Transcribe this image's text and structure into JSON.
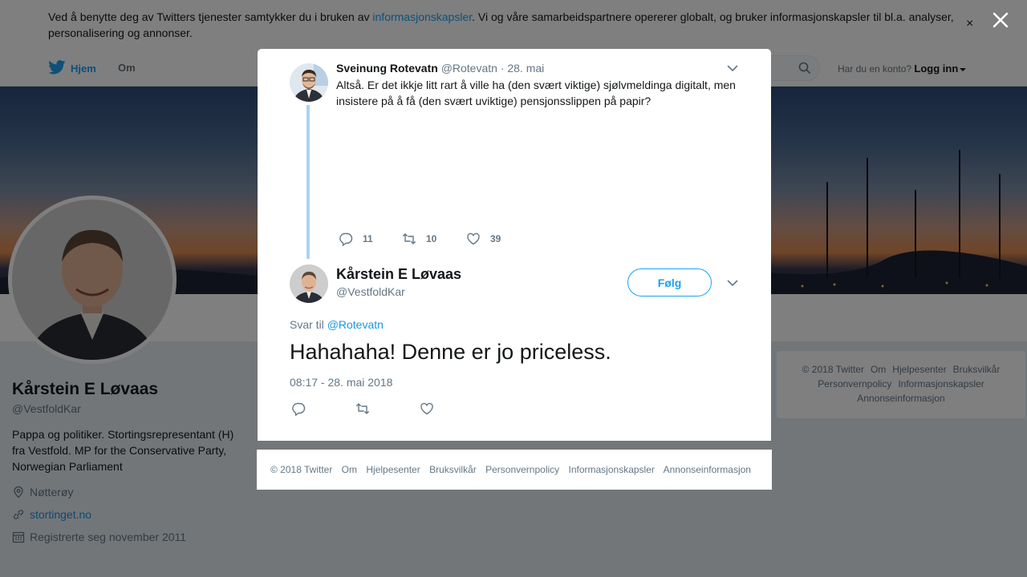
{
  "cookie_banner": {
    "text_before": "Ved å benytte deg av Twitters tjenester samtykker du i bruken av ",
    "link": "informasjonskapsler",
    "text_after": ". Vi og våre samarbeidspartnere opererer globalt, og bruker informasjonskapsler til bl.a. analyser, personalisering og annonser.",
    "close": "×"
  },
  "nav": {
    "home": "Hjem",
    "about": "Om",
    "login_prompt": "Har du en konto?",
    "login": "Logg inn"
  },
  "profile": {
    "name": "Kårstein E Løvaas",
    "handle": "@VestfoldKar",
    "bio": "Pappa og politiker. Stortingsrepresentant (H) fra Vestfold. MP for the Conservative Party, Norwegian Parliament",
    "location": "Nøtterøy",
    "website": "stortinget.no",
    "joined": "Registrerte seg november 2011"
  },
  "side_footer": {
    "items": [
      "© 2018 Twitter",
      "Om",
      "Hjelpesenter",
      "Bruksvilkår",
      "Personvernpolicy",
      "Informasjonskapsler",
      "Annonseinformasjon"
    ]
  },
  "parent_tweet": {
    "name": "Sveinung Rotevatn",
    "handle": "@Rotevatn",
    "date": "· 28. mai",
    "text": "Altså. Er det ikkje litt rart å ville ha (den svært viktige) sjølvmeldinga digitalt, men insistere på å få (den svært uviktige) pensjonsslippen på papir?",
    "replies": "11",
    "retweets": "10",
    "likes": "39"
  },
  "main_tweet": {
    "name": "Kårstein E Løvaas",
    "handle": "@VestfoldKar",
    "follow": "Følg",
    "reply_prefix": "Svar til",
    "reply_to": "@Rotevatn",
    "text": "Hahahaha! Denne er jo priceless.",
    "timestamp": "08:17 - 28. mai 2018"
  },
  "modal_footer": {
    "items": [
      "© 2018 Twitter",
      "Om",
      "Hjelpesenter",
      "Bruksvilkår",
      "Personvernpolicy",
      "Informasjonskapsler",
      "Annonseinformasjon"
    ]
  },
  "icons": {
    "bird": "twitter-bird-icon",
    "search": "search-icon",
    "close": "close-icon",
    "reply": "reply-icon",
    "retweet": "retweet-icon",
    "like": "heart-icon",
    "chevron": "chevron-down-icon",
    "location": "location-pin-icon",
    "link": "link-icon",
    "calendar": "calendar-icon"
  },
  "colors": {
    "brand": "#1da1f2",
    "link": "#1b95e0",
    "thread_line": "#a9d4f5",
    "secondary_text": "#657786"
  }
}
